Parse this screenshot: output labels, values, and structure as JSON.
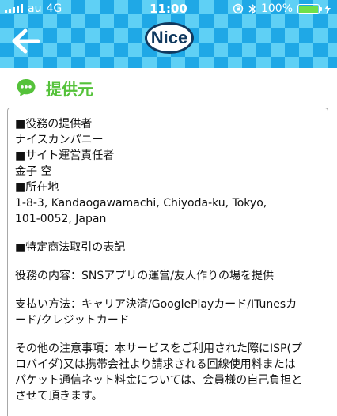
{
  "status_bar": {
    "carrier": "au",
    "network": "4G",
    "time": "11:00",
    "battery": "100%",
    "battery_level": 1.0,
    "battery_color": "#6fe04a",
    "icons": [
      "signal-icon",
      "lock-rotation-icon",
      "bluetooth-icon",
      "battery-icon",
      "charging-icon"
    ]
  },
  "header": {
    "logo": "Nice",
    "back_icon": "back-arrow-icon",
    "colors": {
      "checker_light": "#5fd0f5",
      "checker_dark": "#1fa8e6",
      "logo_border": "#10395f"
    }
  },
  "section": {
    "title": "提供元",
    "icon": "chat-bubble-icon",
    "accent": "#55c23a"
  },
  "content": {
    "lines": [
      "■役務の提供者",
      "ナイスカンパニー",
      "■サイト運営責任者",
      "金子 空",
      "■所在地",
      "1-8-3, Kandaogawamachi, Chiyoda-ku, Tokyo,",
      "101-0052, Japan",
      "",
      "■特定商法取引の表記",
      "",
      "役務の内容：SNSアプリの運営/友人作りの場を提供",
      "",
      "支払い方法：キャリア決済/GooglePlayカード/ITunesカ",
      "ード/クレジットカード",
      "",
      "その他の注意事項：本サービスをご利用された際にISP(プ",
      "ロバイダ)又は携帯会社より請求される回線使用料または",
      "パケット通信ネット料金については、会員様の自己負担と",
      "させて頂きます。"
    ]
  }
}
